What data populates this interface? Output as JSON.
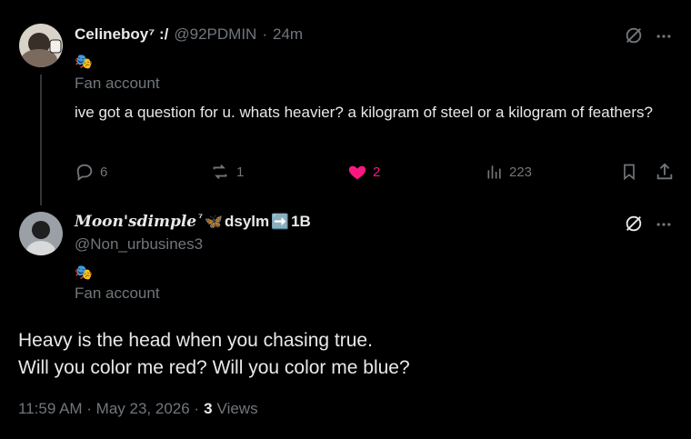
{
  "reply": {
    "display_name": "Celineboy",
    "name_suffix": "⁷ :/",
    "handle": "@92PDMIN",
    "separator": "·",
    "time": "24m",
    "badge_emoji": "🎭",
    "affiliation": "Fan account",
    "text": "ive got a question for u. whats heavier? a kilogram of steel or a kilogram of feathers?",
    "stats": {
      "replies": "6",
      "reposts": "1",
      "likes": "2",
      "views": "223"
    },
    "like_color": "#f91880"
  },
  "main": {
    "display_name_styled": "𝑴𝒐𝒐𝒏'𝒔𝒅𝒊𝒎𝒑𝒍𝒆",
    "display_name_sup": "⁷",
    "display_name_emoji": "🦋",
    "display_name_rest": "dsylm",
    "arrow_emoji": "➡️",
    "display_name_end": "1B",
    "handle": "@Non_urbusines3",
    "badge_emoji": "🎭",
    "affiliation": "Fan account",
    "text_line1": "Heavy is the head when you chasing true.",
    "text_line2": "Will you color me red? Will you color me blue?",
    "timestamp": "11:59 AM · May 23, 2026 ·",
    "views_count": "3",
    "views_label": "Views"
  },
  "icons": {
    "grok": "grok-icon",
    "more": "more-icon",
    "reply": "reply-icon",
    "repost": "repost-icon",
    "like": "heart-icon",
    "views": "views-icon",
    "bookmark": "bookmark-icon",
    "share": "share-icon"
  }
}
